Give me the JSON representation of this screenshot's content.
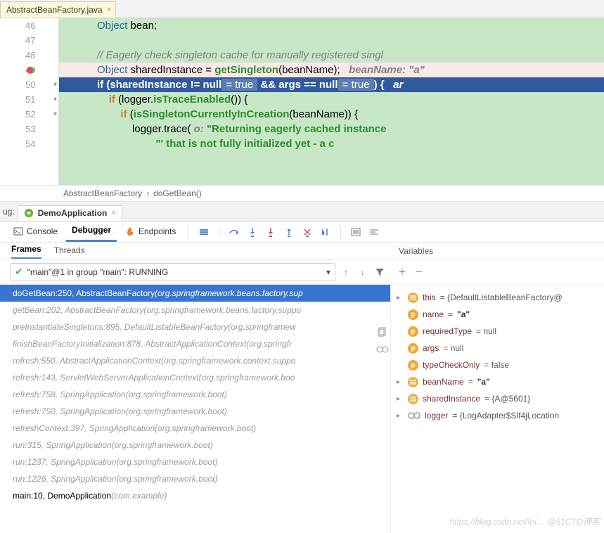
{
  "file_tab": {
    "name": "AbstractBeanFactory.java"
  },
  "gutter": {
    "start": 46,
    "lines": [
      46,
      47,
      48,
      49,
      50,
      51,
      52,
      53,
      54
    ],
    "breakpoint_line": 49
  },
  "code": {
    "l46": {
      "indent": "            ",
      "t1": "Object ",
      "t2": "bean",
      "t3": ";"
    },
    "l48": {
      "indent": "            ",
      "comment": "// Eagerly check singleton cache for manually registered singl"
    },
    "l49": {
      "indent": "            ",
      "typ": "Object ",
      "var": "sharedInstance ",
      "eq": "= ",
      "mth": "getSingleton",
      "op": "(",
      "arg": "beanName",
      "cp": ");   ",
      "hint": "beanName: \"a\""
    },
    "l50": {
      "indent": "            ",
      "kw1": "if ",
      "op": "(",
      "v1": "sharedInstance ",
      "ne": "!= ",
      "nul1": "null",
      "pill1": " = true ",
      "amp": " && ",
      "v2": "args ",
      "eq2": "== ",
      "nul2": "null",
      "pill2": " = true ",
      "cp": ") {   ",
      "hint": "ar"
    },
    "l51": {
      "indent": "                ",
      "kw": "if ",
      "op": "(",
      "var1": "logger",
      "dot": ".",
      "mth": "isTraceEnabled",
      "cp": "()) {"
    },
    "l52": {
      "indent": "                    ",
      "kw": "if ",
      "op": "(",
      "mth": "isSingletonCurrentlyInCreation",
      "op2": "(",
      "arg": "beanName",
      "cp": ")) {"
    },
    "l53": {
      "indent": "                        ",
      "var": "logger",
      "dot": ".",
      "mth": "trace",
      "op": "( ",
      "hint": "o: ",
      "str": "\"Returning eagerly cached instance"
    },
    "l54": {
      "indent": "                                ",
      "str": "\"' that is not fully initialized yet - a c"
    }
  },
  "breadcrumb": {
    "a": "AbstractBeanFactory",
    "b": "doGetBean()"
  },
  "debug": {
    "prefix": "ug:",
    "run_config": "DemoApplication",
    "tabs": {
      "console": "Console",
      "debugger": "Debugger",
      "endpoints": "Endpoints"
    },
    "frames_tab": "Frames",
    "threads_tab": "Threads",
    "variables_label": "Variables",
    "thread_selector": "\"main\"@1 in group \"main\": RUNNING"
  },
  "frames": [
    {
      "sel": true,
      "m": "doGetBean:250, AbstractBeanFactory ",
      "pkg": "(org.springframework.beans.factory.sup"
    },
    {
      "sel": false,
      "dim": true,
      "m": "getBean:202, AbstractBeanFactory ",
      "pkg": "(org.springframework.beans.factory.suppo"
    },
    {
      "sel": false,
      "dim": true,
      "m": "preInstantiateSingletons:895, DefaultListableBeanFactory ",
      "pkg": "(org.springframew"
    },
    {
      "sel": false,
      "dim": true,
      "m": "finishBeanFactoryInitialization:878, AbstractApplicationContext ",
      "pkg": "(org.springfr"
    },
    {
      "sel": false,
      "dim": true,
      "m": "refresh:550, AbstractApplicationContext ",
      "pkg": "(org.springframework.context.suppo"
    },
    {
      "sel": false,
      "dim": true,
      "m": "refresh:143, ServletWebServerApplicationContext ",
      "pkg": "(org.springframework.boo"
    },
    {
      "sel": false,
      "dim": true,
      "m": "refresh:758, SpringApplication ",
      "pkg": "(org.springframework.boot)"
    },
    {
      "sel": false,
      "dim": true,
      "m": "refresh:750, SpringApplication ",
      "pkg": "(org.springframework.boot)"
    },
    {
      "sel": false,
      "dim": true,
      "m": "refreshContext:397, SpringApplication ",
      "pkg": "(org.springframework.boot)"
    },
    {
      "sel": false,
      "dim": true,
      "m": "run:315, SpringApplication ",
      "pkg": "(org.springframework.boot)"
    },
    {
      "sel": false,
      "dim": true,
      "m": "run:1237, SpringApplication ",
      "pkg": "(org.springframework.boot)"
    },
    {
      "sel": false,
      "dim": true,
      "m": "run:1226, SpringApplication ",
      "pkg": "(org.springframework.boot)"
    },
    {
      "sel": false,
      "dim": false,
      "m": "main:10, DemoApplication ",
      "pkg": "(com.example)"
    }
  ],
  "variables": [
    {
      "exp": true,
      "badge": "f",
      "name": "this",
      "val": "= {DefaultListableBeanFactory@",
      "bold": false
    },
    {
      "exp": false,
      "badge": "p",
      "name": "name",
      "val": "= ",
      "bold_val": "\"a\""
    },
    {
      "exp": false,
      "badge": "p",
      "name": "requiredType",
      "val": "= null"
    },
    {
      "exp": false,
      "badge": "p",
      "name": "args",
      "val": "= null"
    },
    {
      "exp": false,
      "badge": "p",
      "name": "typeCheckOnly",
      "val": "= false"
    },
    {
      "exp": true,
      "badge": "f",
      "name": "beanName",
      "val": "= ",
      "bold_val": "\"a\""
    },
    {
      "exp": true,
      "badge": "f",
      "name": "sharedInstance",
      "val": "= {A@5601}"
    },
    {
      "exp": true,
      "badge": "oo",
      "name": "logger",
      "val": "= {LogAdapter$Slf4jLocation"
    }
  ],
  "watermark": "https://blog.csdn.net/fei…  @51CTO博客"
}
